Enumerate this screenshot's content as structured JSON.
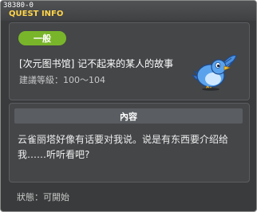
{
  "window": {
    "quest_id": "38380-0",
    "title": "QUEST INFO"
  },
  "quest": {
    "category": "一般",
    "name": "[次元图书馆] 记不起来的某人的故事",
    "level_range": "建議等級：100～104",
    "icon": "blue-bird-icon"
  },
  "content": {
    "header": "內容",
    "description": "云雀丽塔好像有话要对我说。说是有东西要介绍给我……听听看吧?"
  },
  "footer": {
    "status": "狀態：可開始"
  },
  "colors": {
    "title": "#ffd44a",
    "badge": "#79b52a",
    "background": "#3a3b3c",
    "panel": "#444648"
  }
}
